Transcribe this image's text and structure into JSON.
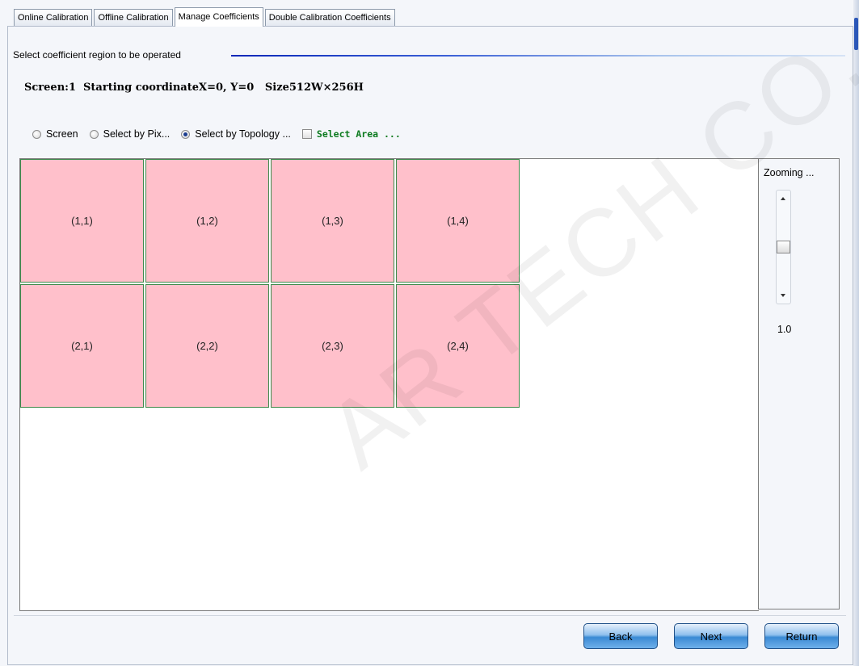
{
  "tabs": [
    "Online Calibration",
    "Offline Calibration",
    "Manage Coefficients",
    "Double Calibration Coefficients"
  ],
  "section_title": "Select coefficient region to be operated",
  "info_line": "Screen:1  Starting coordinateX=0, Y=0   Size512W×256H",
  "options": {
    "screen": "Screen",
    "by_pixel": "Select by Pix...",
    "by_topology": "Select by Topology ...",
    "select_area": "Select Area ...",
    "selected": "by_topology"
  },
  "cells": [
    "(1,1)",
    "(1,2)",
    "(1,3)",
    "(1,4)",
    "(2,1)",
    "(2,2)",
    "(2,3)",
    "(2,4)"
  ],
  "zoom": {
    "title": "Zooming ...",
    "value": "1.0",
    "level": 0.5
  },
  "buttons": {
    "back": "Back",
    "next": "Next",
    "return": "Return"
  },
  "watermark": "AR TECH CO.,LTD",
  "colors": {
    "cell_fill": "#ffc0cb",
    "cell_border": "#3f8a4c",
    "area_label": "#0b7a1e",
    "button_blue": "#3a8ad4"
  }
}
